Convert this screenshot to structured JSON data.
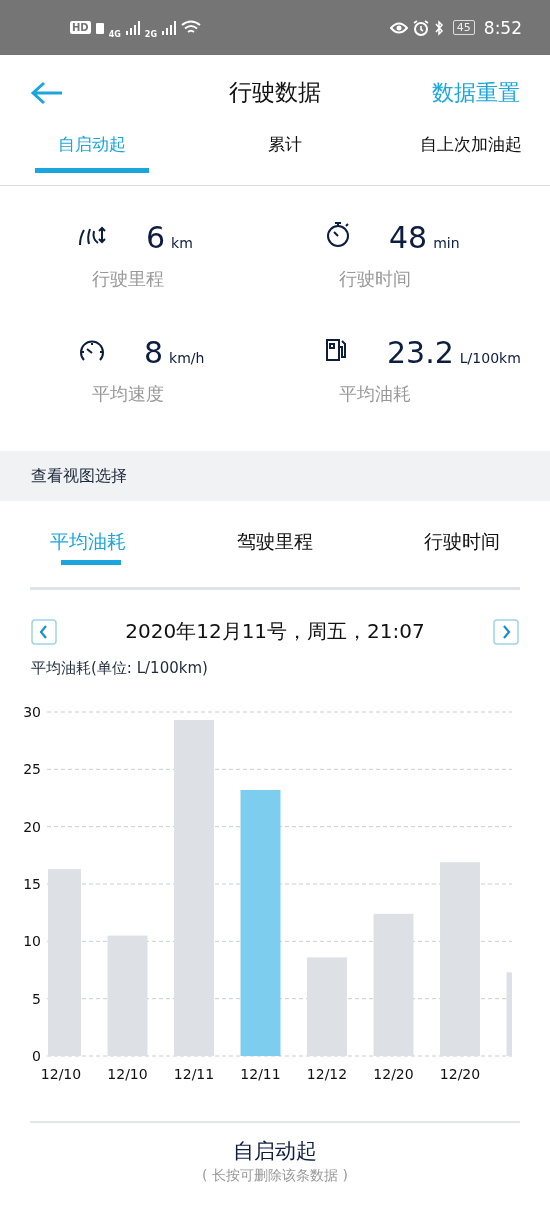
{
  "status_bar": {
    "time": "8:52",
    "battery": "45",
    "network_1": "4G",
    "network_2": "2G",
    "hd": "HD"
  },
  "header": {
    "title": "行驶数据",
    "action": "数据重置"
  },
  "tabs": [
    {
      "label": "自启动起",
      "selected": true
    },
    {
      "label": "累计",
      "selected": false
    },
    {
      "label": "自上次加油起",
      "selected": false
    }
  ],
  "stats": [
    {
      "kind": "distance",
      "value": "6",
      "unit": "km",
      "label": "行驶里程"
    },
    {
      "kind": "time",
      "value": "48",
      "unit": "min",
      "label": "行驶时间"
    },
    {
      "kind": "speed",
      "value": "8",
      "unit": "km/h",
      "label": "平均速度"
    },
    {
      "kind": "fuel",
      "value": "23.2",
      "unit": "L/100km",
      "label": "平均油耗"
    }
  ],
  "section_title": "查看视图选择",
  "view_tabs": [
    {
      "label": "平均油耗",
      "selected": true
    },
    {
      "label": "驾驶里程",
      "selected": false
    },
    {
      "label": "行驶时间",
      "selected": false
    }
  ],
  "date": "2020年12月11号，周五，21:07",
  "chart_label": "平均油耗(单位: L/100km)",
  "chart_data": {
    "type": "bar",
    "categories": [
      "12/10",
      "12/10",
      "12/11",
      "12/11",
      "12/12",
      "12/20",
      "12/20",
      null
    ],
    "series": [
      {
        "color": "#dde1e5",
        "values": [
          16.3,
          10.5,
          29.3,
          null,
          8.6,
          12.4,
          16.9,
          7.3
        ]
      },
      {
        "color": "#7ccdee",
        "values": [
          null,
          null,
          null,
          23.2,
          null,
          null,
          null,
          null
        ]
      }
    ],
    "grid": true,
    "ylim": [
      0,
      30
    ],
    "yticks": [
      0,
      5,
      10,
      15,
      20,
      25,
      30
    ]
  },
  "footer": {
    "title": "自启动起",
    "hint": "( 长按可删除该条数据 )"
  }
}
